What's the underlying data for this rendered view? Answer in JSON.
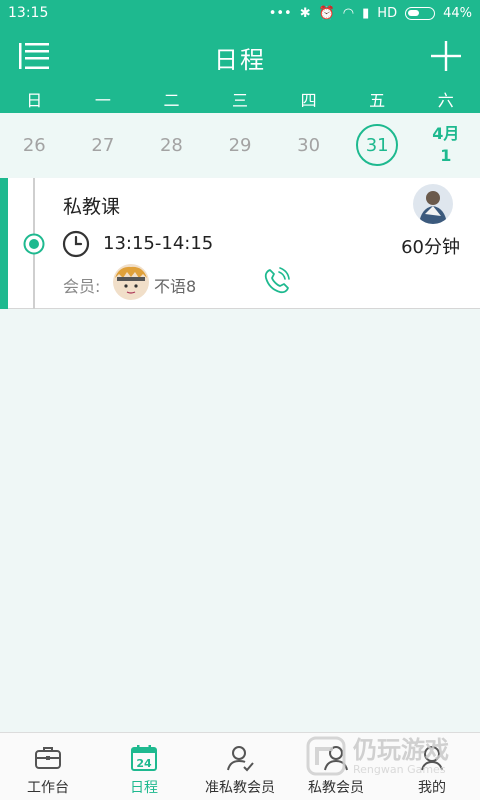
{
  "status_bar": {
    "time": "13:15",
    "network": "HD",
    "battery": "44%"
  },
  "header": {
    "title": "日程"
  },
  "week": {
    "days": [
      "日",
      "一",
      "二",
      "三",
      "四",
      "五",
      "六"
    ],
    "dates": [
      "26",
      "27",
      "28",
      "29",
      "30",
      "31"
    ],
    "selected_date": "31",
    "next_month": "4月",
    "next_day": "1"
  },
  "appointment": {
    "course": "私教课",
    "time_range": "13:15-14:15",
    "duration": "60分钟",
    "member_label": "会员:",
    "member_name": "不语8"
  },
  "tabs": [
    {
      "label": "工作台",
      "icon": "briefcase-icon"
    },
    {
      "label": "日程",
      "icon": "calendar-icon",
      "badge": "24"
    },
    {
      "label": "准私教会员",
      "icon": "user-check-icon"
    },
    {
      "label": "私教会员",
      "icon": "user-icon"
    },
    {
      "label": "我的",
      "icon": "person-icon"
    }
  ],
  "watermark": {
    "cn": "仍玩游戏",
    "en": "Rengwan Games"
  },
  "colors": {
    "accent": "#1eb98f",
    "background": "#eff7f6"
  }
}
